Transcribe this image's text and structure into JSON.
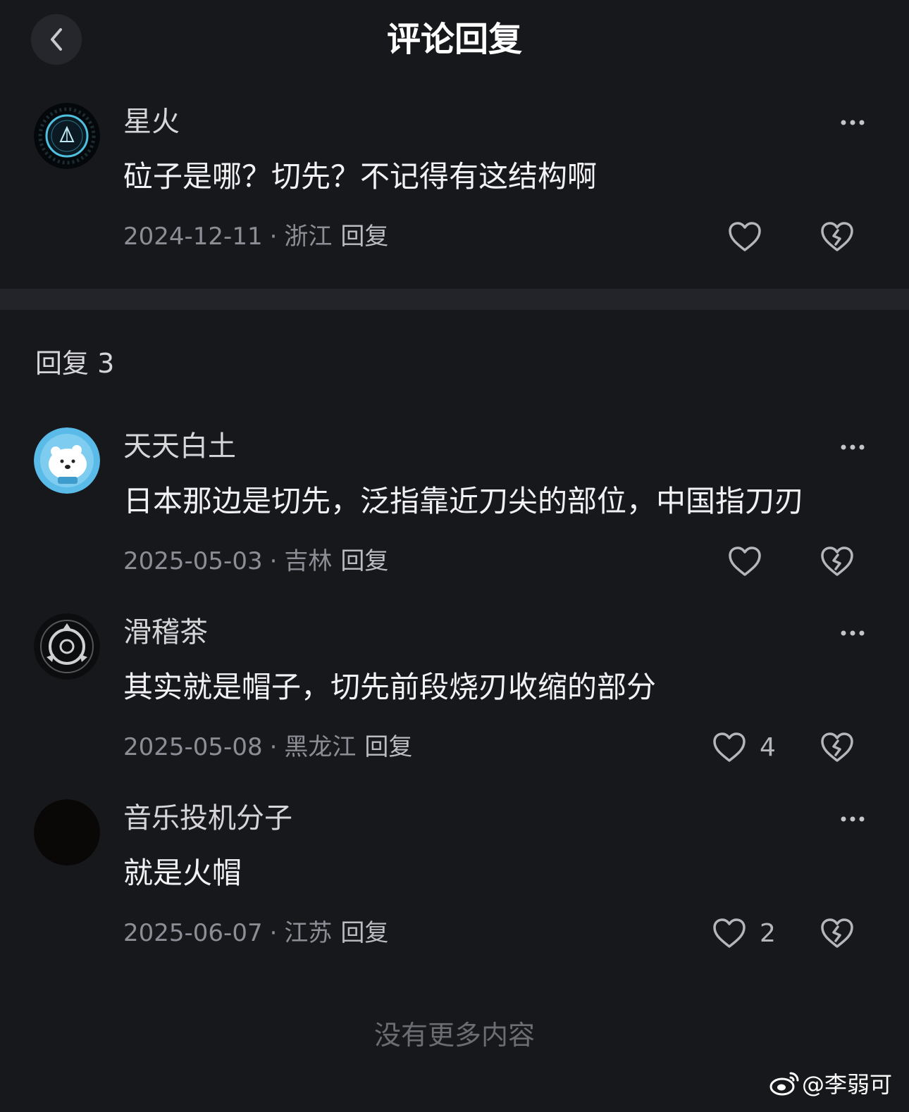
{
  "header": {
    "title": "评论回复",
    "back_icon": "chevron-left-icon"
  },
  "main_comment": {
    "username": "星火",
    "content": "砬子是哪？切先？不记得有这结构啊",
    "date": "2024-12-11",
    "separator": "·",
    "location": "浙江",
    "reply_label": "回复",
    "like_count": ""
  },
  "replies_section": {
    "title": "回复 3"
  },
  "replies": [
    {
      "username": "天天白土",
      "content": "日本那边是切先，泛指靠近刀尖的部位，中国指刀刃",
      "date": "2025-05-03",
      "separator": "·",
      "location": "吉林",
      "reply_label": "回复",
      "like_count": ""
    },
    {
      "username": "滑稽茶",
      "content": "其实就是帽子，切先前段烧刃收缩的部分",
      "date": "2025-05-08",
      "separator": "·",
      "location": "黑龙江",
      "reply_label": "回复",
      "like_count": "4"
    },
    {
      "username": "音乐投机分子",
      "content": "就是火帽",
      "date": "2025-06-07",
      "separator": "·",
      "location": "江苏",
      "reply_label": "回复",
      "like_count": "2"
    }
  ],
  "footer": {
    "end_text": "没有更多内容"
  },
  "watermark": {
    "text": "@李弱可",
    "icon": "weibo-logo-icon"
  },
  "colors": {
    "background": "#17181c",
    "divider": "#22242a",
    "icon": "#b5b6bc"
  }
}
